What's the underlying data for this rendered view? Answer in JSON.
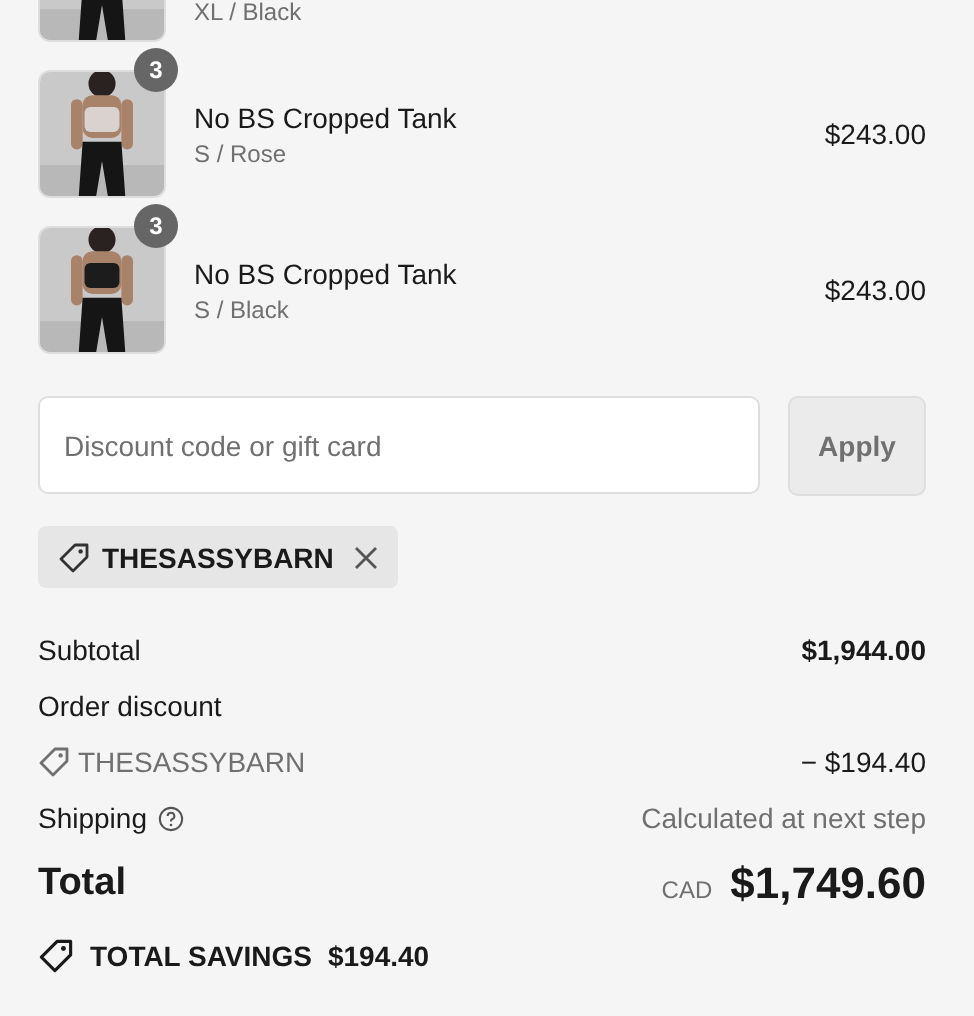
{
  "line_items": [
    {
      "variant": "XL / Black"
    },
    {
      "quantity": "3",
      "name": "No BS Cropped Tank",
      "variant": "S / Rose",
      "price": "$243.00"
    },
    {
      "quantity": "3",
      "name": "No BS Cropped Tank",
      "variant": "S / Black",
      "price": "$243.00"
    }
  ],
  "discount": {
    "placeholder": "Discount code or gift card",
    "apply_label": "Apply"
  },
  "applied_codes": [
    {
      "code": "THESASSYBARN"
    }
  ],
  "summary": {
    "subtotal": {
      "label": "Subtotal",
      "value": "$1,944.00"
    },
    "order_discount": {
      "label": "Order discount"
    },
    "discount_lines": [
      {
        "code": "THESASSYBARN",
        "amount": "− $194.40"
      }
    ],
    "shipping": {
      "label": "Shipping",
      "value": "Calculated at next step"
    },
    "total": {
      "label": "Total",
      "currency": "CAD",
      "amount": "$1,749.60"
    },
    "savings": {
      "label": "TOTAL SAVINGS",
      "amount": "$194.40"
    }
  }
}
